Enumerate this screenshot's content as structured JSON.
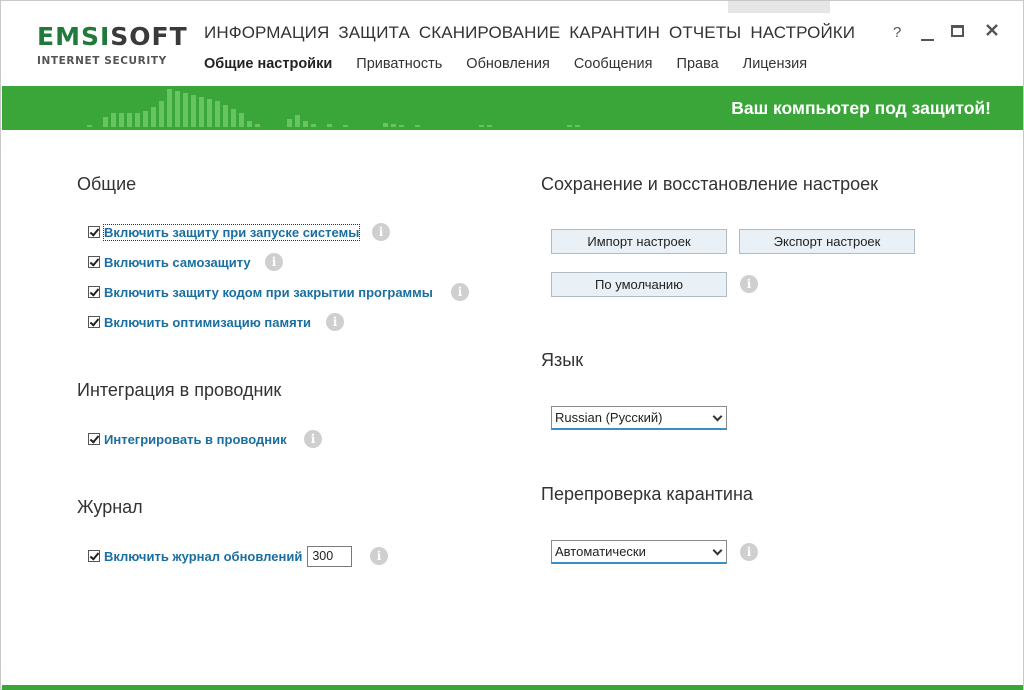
{
  "logo": {
    "brand_part1": "EMSI",
    "brand_part2": "SOFT",
    "product": "INTERNET SECURITY"
  },
  "nav": {
    "main": [
      "ИНФОРМАЦИЯ",
      "ЗАЩИТА",
      "СКАНИРОВАНИЕ",
      "КАРАНТИН",
      "ОТЧЕТЫ",
      "НАСТРОЙКИ"
    ],
    "active_main": "НАСТРОЙКИ",
    "sub": [
      "Общие настройки",
      "Приватность",
      "Обновления",
      "Сообщения",
      "Права",
      "Лицензия"
    ],
    "active_sub": "Общие настройки"
  },
  "window_controls": {
    "help": "?"
  },
  "status": {
    "text": "Ваш компьютер под защитой!"
  },
  "general": {
    "title": "Общие",
    "options": [
      {
        "label": "Включить защиту при запуске системы",
        "checked": true
      },
      {
        "label": "Включить самозащиту",
        "checked": true
      },
      {
        "label": "Включить защиту кодом при закрытии программы",
        "checked": true
      },
      {
        "label": "Включить оптимизацию памяти",
        "checked": true
      }
    ]
  },
  "explorer": {
    "title": "Интеграция в проводник",
    "option": {
      "label": "Интегрировать в проводник",
      "checked": true
    }
  },
  "journal": {
    "title": "Журнал",
    "option": {
      "label": "Включить журнал обновлений",
      "checked": true
    },
    "value": "300"
  },
  "backup": {
    "title": "Сохранение и восстановление настроек",
    "import_label": "Импорт настроек",
    "export_label": "Экспорт настроек",
    "default_label": "По умолчанию"
  },
  "language": {
    "title": "Язык",
    "selected": "Russian (Русский)"
  },
  "quarantine": {
    "title": "Перепроверка карантина",
    "selected": "Автоматически"
  },
  "info_glyph": "i",
  "colors": {
    "accent_green": "#3aa63a",
    "label_blue": "#1a6fa0",
    "brand_green": "#1f7a3b"
  }
}
